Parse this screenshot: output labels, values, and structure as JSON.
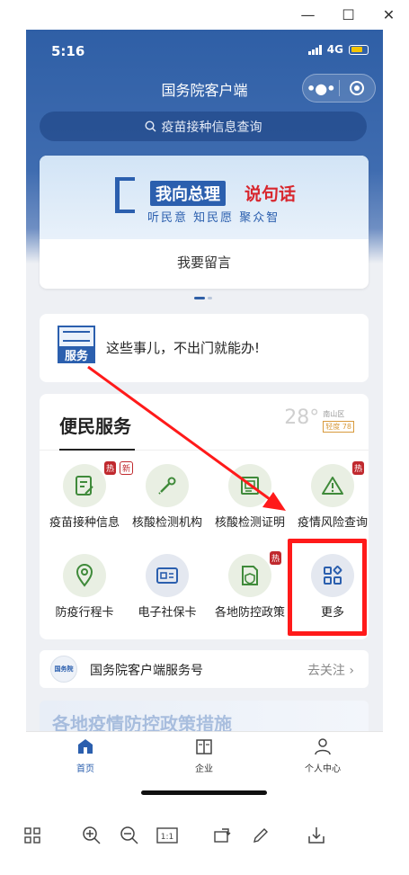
{
  "window": {
    "controls": [
      "—",
      "☐",
      "✕"
    ]
  },
  "status": {
    "time": "5:16",
    "network": "4G"
  },
  "header": {
    "title": "国务院客户端",
    "menu_label": "•●•"
  },
  "search": {
    "placeholder": "疫苗接种信息查询"
  },
  "banner": {
    "title_a": "我向总理",
    "title_b": "说句话",
    "subtitle": "听民意 知民愿 聚众智",
    "button": "我要留言"
  },
  "service": {
    "icon_label": "服务",
    "text": "这些事儿，不出门就能办!"
  },
  "convenience": {
    "title": "便民服务",
    "weather": {
      "temp": "28°",
      "location": "南山区",
      "aqi": "轻度 78"
    },
    "items": [
      {
        "label": "疫苗接种信息",
        "badge": "热",
        "badge2": "新",
        "icon": "vaccine-icon"
      },
      {
        "label": "核酸检测机构",
        "icon": "dropper-icon"
      },
      {
        "label": "核酸检测证明",
        "icon": "certificate-icon"
      },
      {
        "label": "疫情风险查询",
        "badge": "热",
        "icon": "warning-icon"
      },
      {
        "label": "防疫行程卡",
        "icon": "location-icon"
      },
      {
        "label": "电子社保卡",
        "icon": "id-card-icon"
      },
      {
        "label": "各地防控政策",
        "badge": "热",
        "icon": "shield-doc-icon"
      },
      {
        "label": "更多",
        "icon": "grid-more-icon"
      }
    ]
  },
  "follow": {
    "logo": "国务院",
    "name": "国务院客户端服务号",
    "action": "去关注 ›"
  },
  "strip": {
    "text": "各地疫情防控政策措施"
  },
  "tabs": [
    {
      "label": "首页",
      "icon": "home-icon",
      "active": true
    },
    {
      "label": "企业",
      "icon": "building-icon"
    },
    {
      "label": "个人中心",
      "icon": "person-icon"
    }
  ],
  "colors": {
    "primary": "#2f5fa6",
    "highlight": "#ff1a1a",
    "hot_badge": "#c0292e"
  }
}
